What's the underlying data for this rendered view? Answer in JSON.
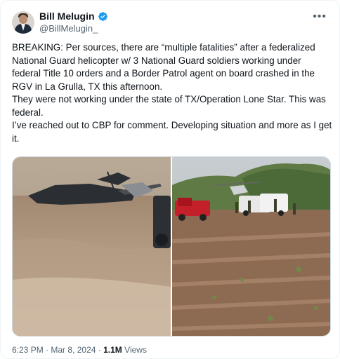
{
  "author": {
    "name": "Bill Melugin",
    "handle": "@BillMelugin_",
    "verified": true
  },
  "tweet": {
    "text": "BREAKING: Per sources, there are “multiple fatalities” after a federalized National Guard helicopter w/ 3 National Guard soldiers working under federal Title 10 orders and a Border Patrol agent on board crashed in the RGV in La Grulla, TX this afternoon.\nThey were not working under the state of TX/Operation Lone Star. This was federal.\nI’ve reached out to CBP for comment. Developing situation and more as I get it."
  },
  "footer": {
    "time": "6:23 PM",
    "separator": "·",
    "date": "Mar 8, 2024",
    "views_count": "1.1M",
    "views_label": "Views"
  },
  "icons": {
    "verified": "verified-badge-icon",
    "more": "more-options-icon"
  },
  "colors": {
    "verified_blue": "#1d9bf0",
    "secondary_text": "#536471"
  }
}
